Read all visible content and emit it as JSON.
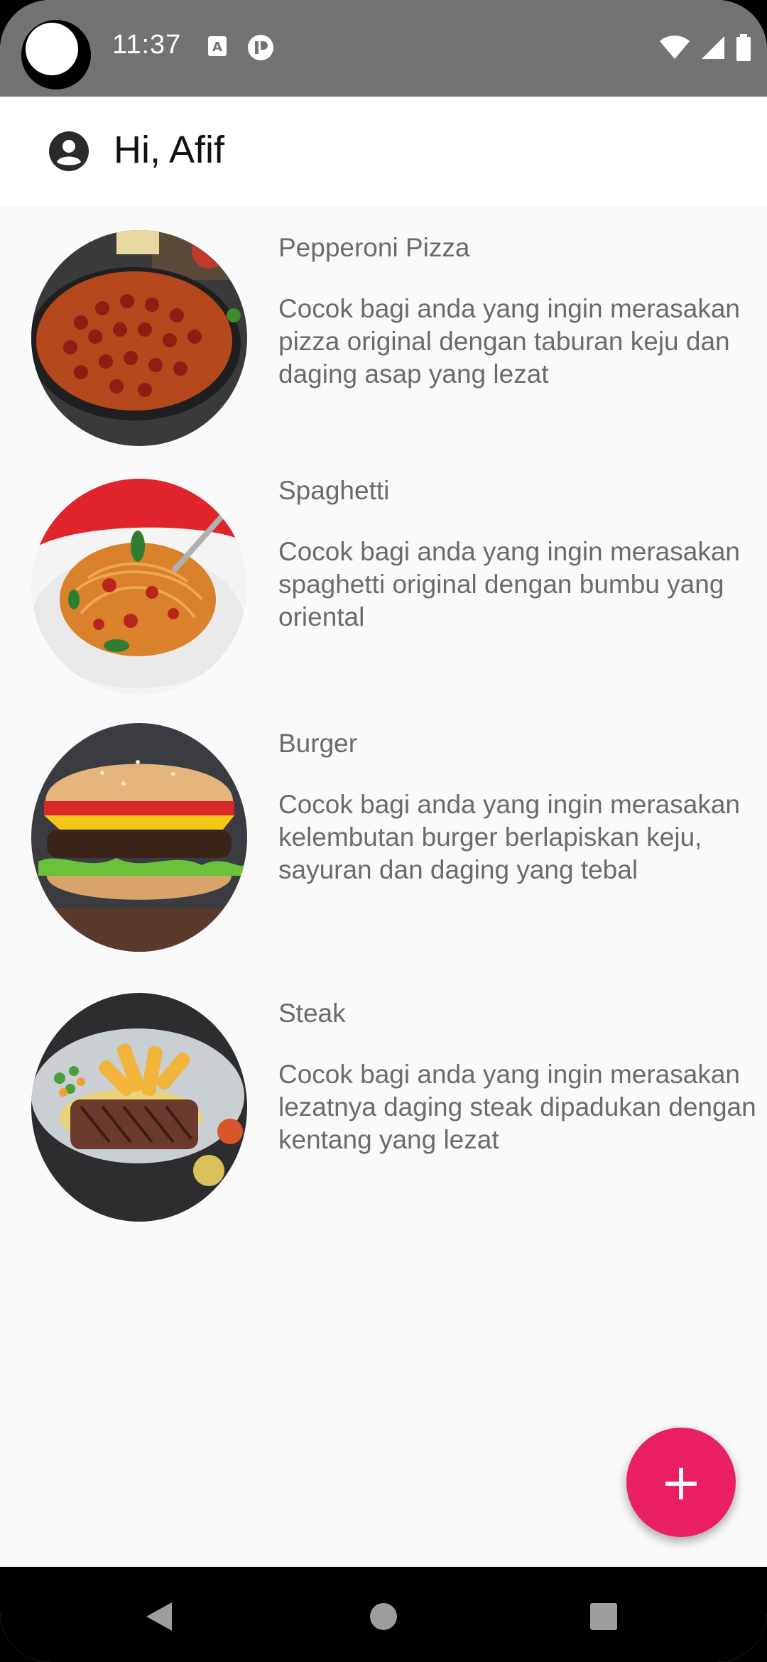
{
  "status_bar": {
    "time": "11:37",
    "left_icons": [
      "camera-cutout",
      "text-a-icon",
      "pause-circle-icon"
    ],
    "right_icons": [
      "wifi-icon",
      "signal-icon",
      "battery-icon"
    ]
  },
  "app_bar": {
    "icon": "account-circle-icon",
    "greeting": "Hi, Afif"
  },
  "foods": [
    {
      "title": "Pepperoni Pizza",
      "description": "Cocok bagi anda yang ingin merasakan pizza original dengan taburan keju dan daging asap yang lezat"
    },
    {
      "title": "Spaghetti",
      "description": "Cocok bagi anda yang ingin merasakan spaghetti original dengan bumbu yang oriental"
    },
    {
      "title": "Burger",
      "description": "Cocok bagi anda yang ingin merasakan kelembutan burger berlapiskan keju, sayuran dan daging yang tebal"
    },
    {
      "title": "Steak",
      "description": "Cocok bagi anda yang ingin merasakan lezatnya daging steak dipadukan dengan kentang yang lezat"
    }
  ],
  "fab": {
    "label": "+",
    "color": "#e91e63"
  },
  "nav": {
    "buttons": [
      "back-icon",
      "home-icon",
      "recents-icon"
    ]
  }
}
